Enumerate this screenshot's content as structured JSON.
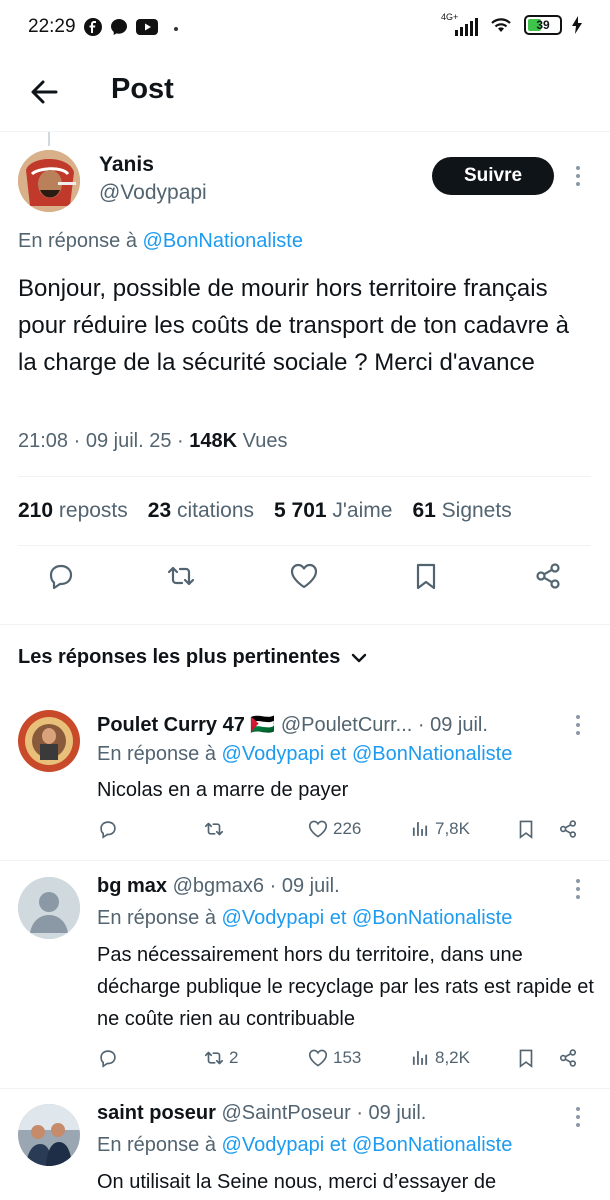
{
  "status_bar": {
    "time": "22:29",
    "network": "4G+",
    "battery": "39"
  },
  "header": {
    "title": "Post"
  },
  "post": {
    "author_name": "Yanis",
    "author_handle": "@Vodypapi",
    "follow_label": "Suivre",
    "reply_prefix": "En réponse à",
    "reply_target": "@BonNationaliste",
    "text": "Bonjour, possible de mourir hors territoire français pour réduire les coûts de transport de ton cadavre à la charge de la sécurité sociale ? Merci d'avance",
    "time": "21:08",
    "date": "09 juil. 25",
    "views_count": "148K",
    "views_label": "Vues",
    "stats": [
      {
        "count": "210",
        "label": "reposts"
      },
      {
        "count": "23",
        "label": "citations"
      },
      {
        "count": "5 701",
        "label": "J'aime"
      },
      {
        "count": "61",
        "label": "Signets"
      }
    ]
  },
  "replies_sort_label": "Les réponses les plus pertinentes",
  "replies": [
    {
      "name": "Poulet Curry 47 🇵🇸",
      "handle": "@PouletCurr...",
      "date": "· 09 juil.",
      "reply_prefix": "En réponse à",
      "reply_targets": "@Vodypapi et @BonNationaliste",
      "text": "Nicolas en a marre de payer",
      "replies_count": "",
      "reposts_count": "",
      "likes_count": "226",
      "views_count": "7,8K"
    },
    {
      "name": "bg max",
      "handle": "@bgmax6",
      "date": "· 09 juil.",
      "reply_prefix": "En réponse à",
      "reply_targets": "@Vodypapi et @BonNationaliste",
      "text": "Pas nécessairement hors du territoire, dans une décharge publique le recyclage par les rats est rapide et ne coûte rien au contribuable",
      "replies_count": "",
      "reposts_count": "2",
      "likes_count": "153",
      "views_count": "8,2K"
    },
    {
      "name": "saint poseur",
      "handle": "@SaintPoseur",
      "date": "· 09 juil.",
      "reply_prefix": "En réponse à",
      "reply_targets": "@Vodypapi et @BonNationaliste",
      "text": "On utilisait la Seine nous, merci d’essayer de"
    }
  ],
  "colors": {
    "link": "#1d9bf0",
    "muted": "#536471",
    "text": "#0f1419",
    "follow_bg": "#0f1419"
  }
}
